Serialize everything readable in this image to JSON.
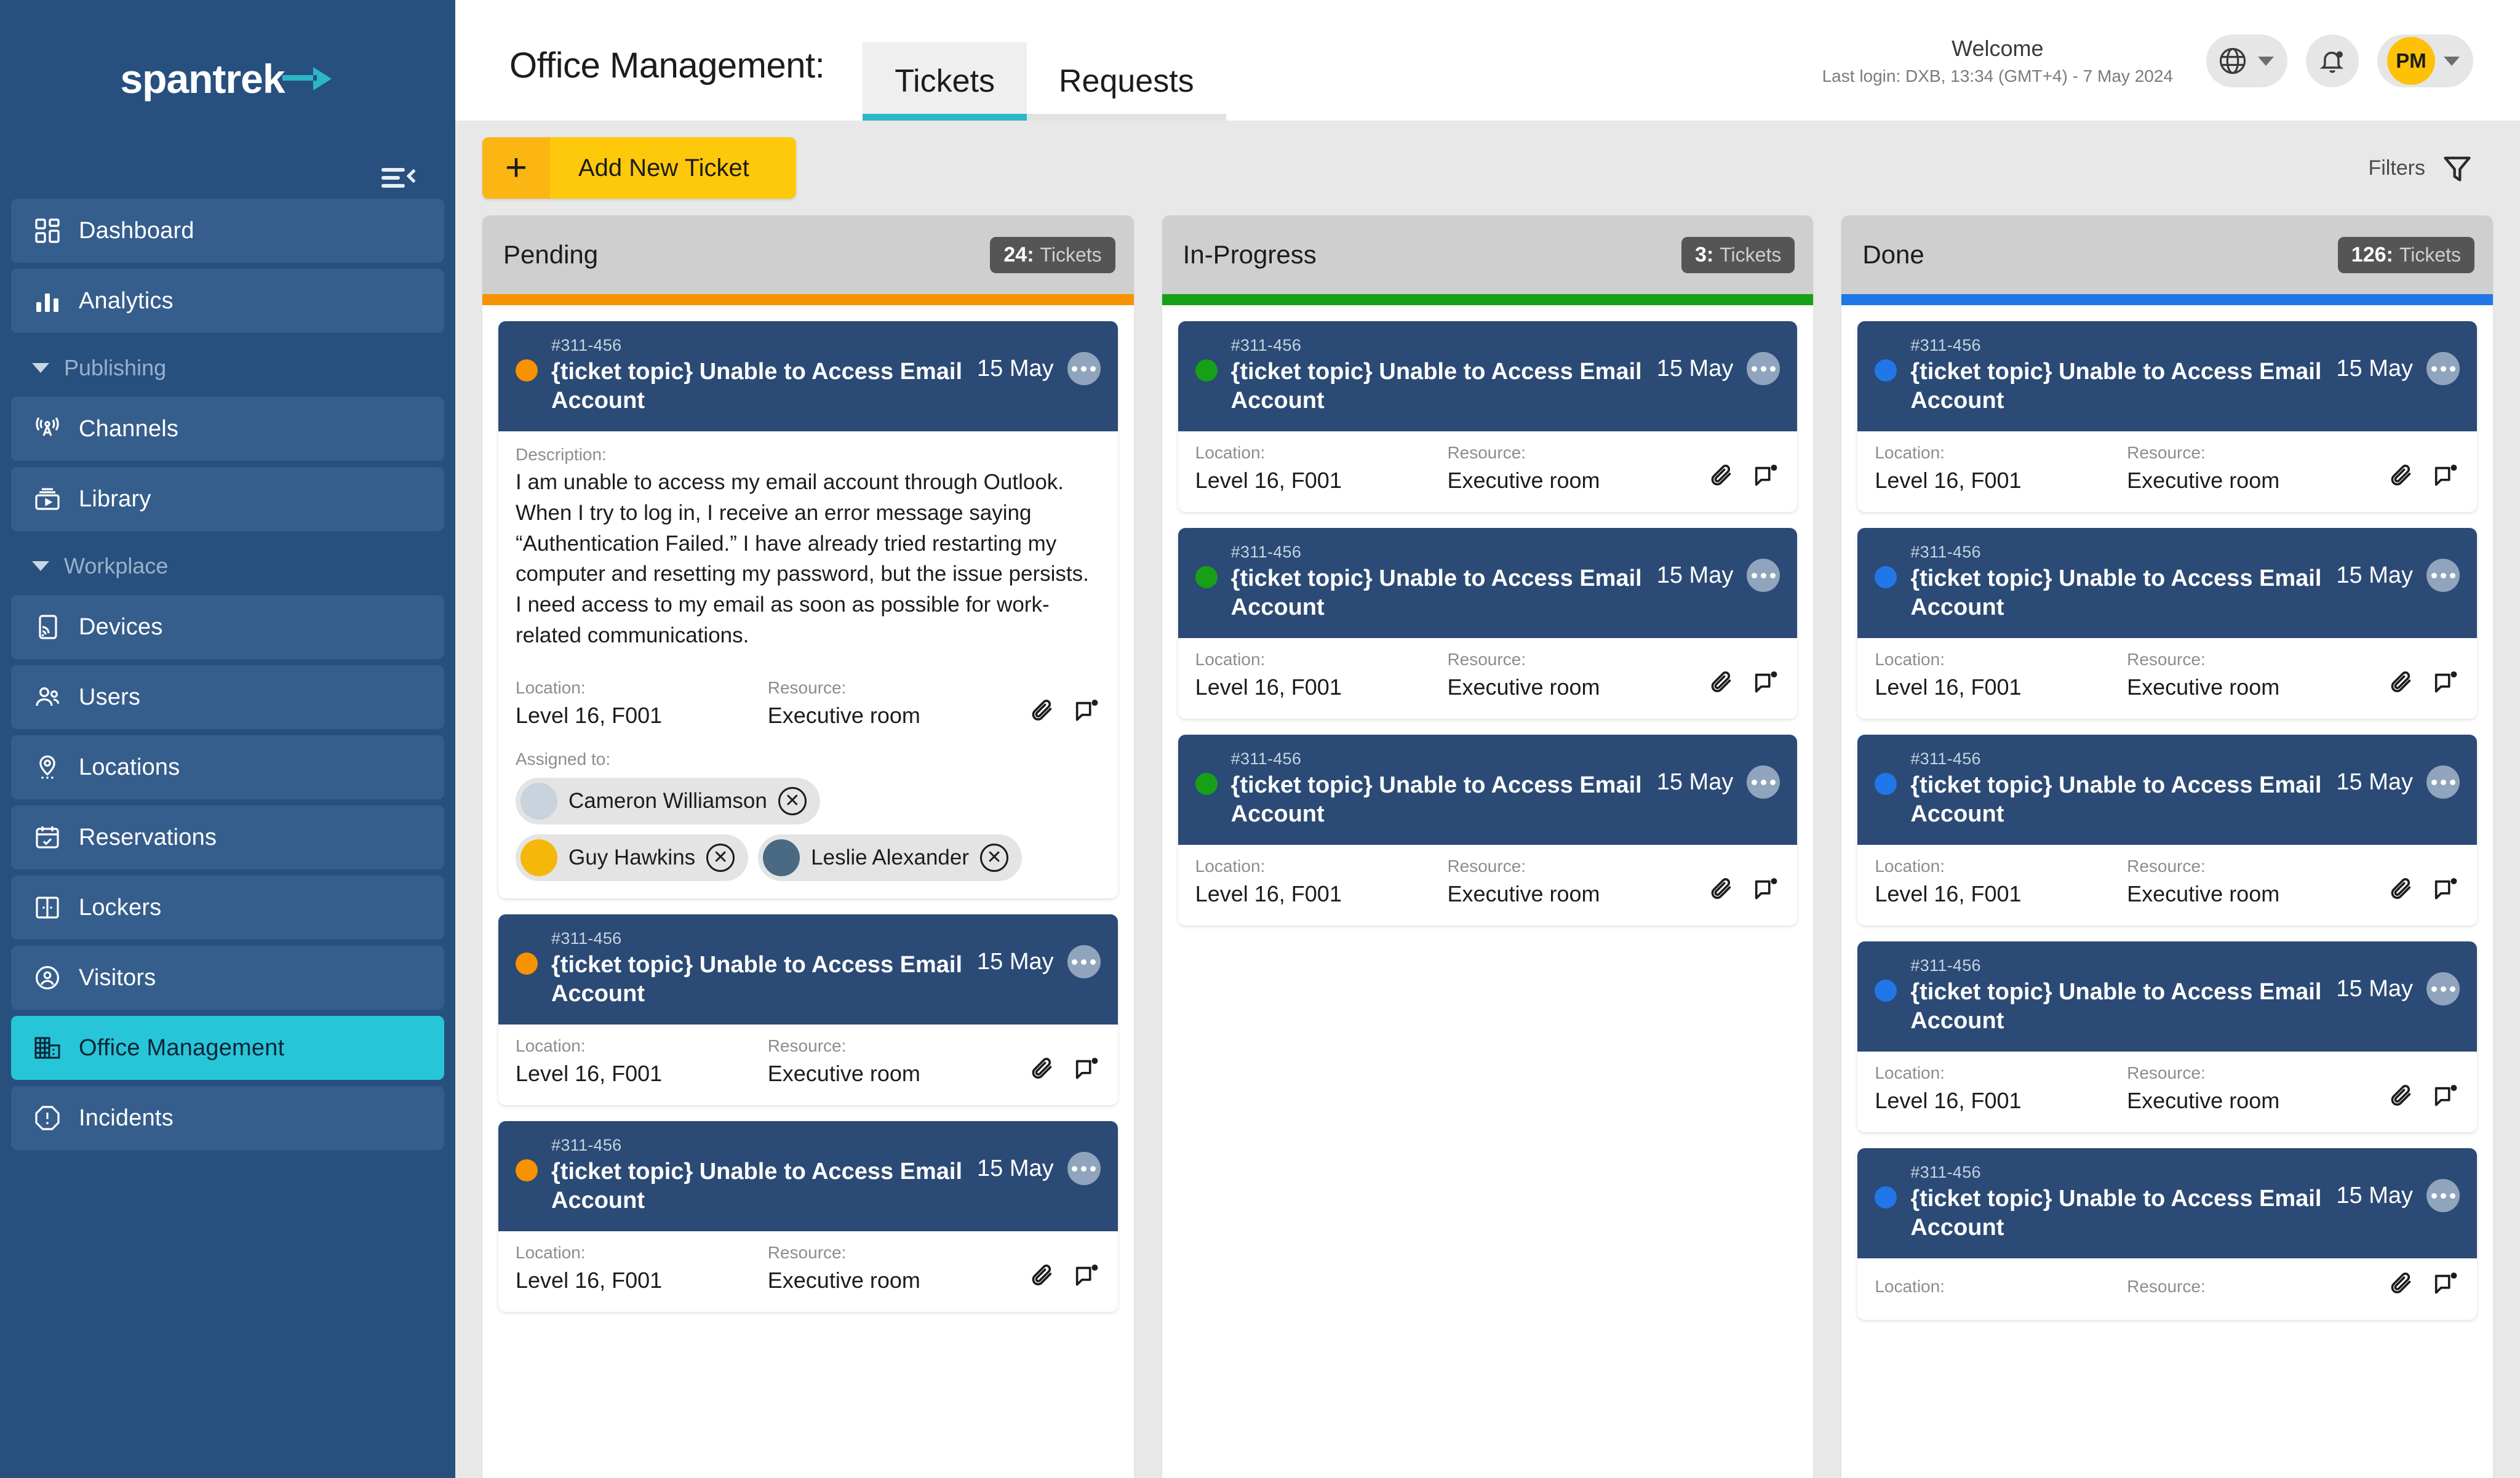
{
  "sidebar": {
    "logo_text": "spantrek",
    "logo_arrow_icon": "arrow-right-icon",
    "collapse_icon": "collapse-sidebar-icon",
    "items": [
      {
        "label": "Dashboard",
        "icon": "dashboard-grid-icon",
        "type": "item",
        "active": false
      },
      {
        "label": "Analytics",
        "icon": "bar-chart-icon",
        "type": "item",
        "active": false
      },
      {
        "label": "Publishing",
        "icon": "caret-down-icon",
        "type": "group"
      },
      {
        "label": "Channels",
        "icon": "broadcast-tower-icon",
        "type": "item",
        "active": false
      },
      {
        "label": "Library",
        "icon": "media-library-icon",
        "type": "item",
        "active": false
      },
      {
        "label": "Workplace",
        "icon": "caret-down-icon",
        "type": "group"
      },
      {
        "label": "Devices",
        "icon": "device-cast-icon",
        "type": "item",
        "active": false
      },
      {
        "label": "Users",
        "icon": "users-icon",
        "type": "item",
        "active": false
      },
      {
        "label": "Locations",
        "icon": "map-pin-icon",
        "type": "item",
        "active": false
      },
      {
        "label": "Reservations",
        "icon": "calendar-check-icon",
        "type": "item",
        "active": false
      },
      {
        "label": "Lockers",
        "icon": "lockers-icon",
        "type": "item",
        "active": false
      },
      {
        "label": "Visitors",
        "icon": "visitor-badge-icon",
        "type": "item",
        "active": false
      },
      {
        "label": "Office Management",
        "icon": "office-building-icon",
        "type": "item",
        "active": true
      },
      {
        "label": "Incidents",
        "icon": "alert-octagon-icon",
        "type": "item",
        "active": false
      }
    ]
  },
  "header": {
    "page_title": "Office Management:",
    "tabs": [
      {
        "label": "Tickets",
        "active": true
      },
      {
        "label": "Requests",
        "active": false
      }
    ],
    "welcome_title": "Welcome",
    "last_login": "Last login: DXB, 13:34 (GMT+4) - 7 May 2024",
    "language_icon": "globe-icon",
    "notifications_icon": "bell-icon",
    "avatar_initials": "PM",
    "chevron_icon": "chevron-down-icon"
  },
  "toolbar": {
    "add_ticket_label": "Add New Ticket",
    "add_ticket_plus": "+",
    "filters_label": "Filters",
    "filters_icon": "funnel-icon"
  },
  "colors": {
    "brand_navy": "#27507f",
    "accent_teal": "#26c6d8",
    "accent_yellow": "#ffc90b",
    "card_navy": "#2b4a75",
    "pending": "#f79200",
    "in_progress": "#17a017",
    "done": "#2176e8"
  },
  "board": {
    "columns": [
      {
        "id": "pending",
        "title": "Pending",
        "count": "24:",
        "count_label": "Tickets",
        "bar_color": "#f79200",
        "dot_color": "#f79200",
        "tickets": [
          {
            "id": "#311-456",
            "title": "{ticket topic} Unable to Access Email Account",
            "date": "15 May",
            "more_icon": "ellipsis-icon",
            "expanded": true,
            "description_label": "Description:",
            "description": "I am unable to access my email account through Outlook. When I try to log in, I receive an error message saying “Authentication Failed.” I have already tried restarting my computer and resetting my password, but the issue persists. I need access to my email as soon as possible for work-related communications.",
            "location_label": "Location:",
            "location": "Level 16, F001",
            "resource_label": "Resource:",
            "resource": "Executive room",
            "attachment_icon": "paperclip-icon",
            "comment_icon": "comment-icon",
            "assigned_label": "Assigned to:",
            "assignees": [
              {
                "name": "Cameron Williamson",
                "avatar_color": "#c8d3dd",
                "remove_icon": "close-icon"
              },
              {
                "name": "Guy Hawkins",
                "avatar_color": "#f5b80a",
                "remove_icon": "close-icon"
              },
              {
                "name": "Leslie Alexander",
                "avatar_color": "#4a6a84",
                "remove_icon": "close-icon"
              }
            ]
          },
          {
            "id": "#311-456",
            "title": "{ticket topic} Unable to Access Email Account",
            "date": "15 May",
            "more_icon": "ellipsis-icon",
            "expanded": false,
            "location_label": "Location:",
            "location": "Level 16, F001",
            "resource_label": "Resource:",
            "resource": "Executive room",
            "attachment_icon": "paperclip-icon",
            "comment_icon": "comment-icon"
          },
          {
            "id": "#311-456",
            "title": "{ticket topic} Unable to Access Email Account",
            "date": "15 May",
            "more_icon": "ellipsis-icon",
            "expanded": false,
            "location_label": "Location:",
            "location": "Level 16, F001",
            "resource_label": "Resource:",
            "resource": "Executive room",
            "attachment_icon": "paperclip-icon",
            "comment_icon": "comment-icon"
          }
        ]
      },
      {
        "id": "in-progress",
        "title": "In-Progress",
        "count": "3:",
        "count_label": "Tickets",
        "bar_color": "#17a017",
        "dot_color": "#17a017",
        "tickets": [
          {
            "id": "#311-456",
            "title": "{ticket topic} Unable to Access Email Account",
            "date": "15 May",
            "more_icon": "ellipsis-icon",
            "expanded": false,
            "location_label": "Location:",
            "location": "Level 16, F001",
            "resource_label": "Resource:",
            "resource": "Executive room",
            "attachment_icon": "paperclip-icon",
            "comment_icon": "comment-icon"
          },
          {
            "id": "#311-456",
            "title": "{ticket topic} Unable to Access Email Account",
            "date": "15 May",
            "more_icon": "ellipsis-icon",
            "expanded": false,
            "location_label": "Location:",
            "location": "Level 16, F001",
            "resource_label": "Resource:",
            "resource": "Executive room",
            "attachment_icon": "paperclip-icon",
            "comment_icon": "comment-icon"
          },
          {
            "id": "#311-456",
            "title": "{ticket topic} Unable to Access Email Account",
            "date": "15 May",
            "more_icon": "ellipsis-icon",
            "expanded": false,
            "location_label": "Location:",
            "location": "Level 16, F001",
            "resource_label": "Resource:",
            "resource": "Executive room",
            "attachment_icon": "paperclip-icon",
            "comment_icon": "comment-icon"
          }
        ]
      },
      {
        "id": "done",
        "title": "Done",
        "count": "126:",
        "count_label": "Tickets",
        "bar_color": "#2176e8",
        "dot_color": "#2176e8",
        "tickets": [
          {
            "id": "#311-456",
            "title": "{ticket topic} Unable to Access Email Account",
            "date": "15 May",
            "more_icon": "ellipsis-icon",
            "expanded": false,
            "location_label": "Location:",
            "location": "Level 16, F001",
            "resource_label": "Resource:",
            "resource": "Executive room",
            "attachment_icon": "paperclip-icon",
            "comment_icon": "comment-icon"
          },
          {
            "id": "#311-456",
            "title": "{ticket topic} Unable to Access Email Account",
            "date": "15 May",
            "more_icon": "ellipsis-icon",
            "expanded": false,
            "location_label": "Location:",
            "location": "Level 16, F001",
            "resource_label": "Resource:",
            "resource": "Executive room",
            "attachment_icon": "paperclip-icon",
            "comment_icon": "comment-icon"
          },
          {
            "id": "#311-456",
            "title": "{ticket topic} Unable to Access Email Account",
            "date": "15 May",
            "more_icon": "ellipsis-icon",
            "expanded": false,
            "location_label": "Location:",
            "location": "Level 16, F001",
            "resource_label": "Resource:",
            "resource": "Executive room",
            "attachment_icon": "paperclip-icon",
            "comment_icon": "comment-icon"
          },
          {
            "id": "#311-456",
            "title": "{ticket topic} Unable to Access Email Account",
            "date": "15 May",
            "more_icon": "ellipsis-icon",
            "expanded": false,
            "location_label": "Location:",
            "location": "Level 16, F001",
            "resource_label": "Resource:",
            "resource": "Executive room",
            "attachment_icon": "paperclip-icon",
            "comment_icon": "comment-icon"
          },
          {
            "id": "#311-456",
            "title": "{ticket topic} Unable to Access Email Account",
            "date": "15 May",
            "more_icon": "ellipsis-icon",
            "expanded": false,
            "location_label": "Location:",
            "location": "",
            "resource_label": "Resource:",
            "resource": "",
            "attachment_icon": "paperclip-icon",
            "comment_icon": "comment-icon"
          }
        ]
      }
    ]
  }
}
